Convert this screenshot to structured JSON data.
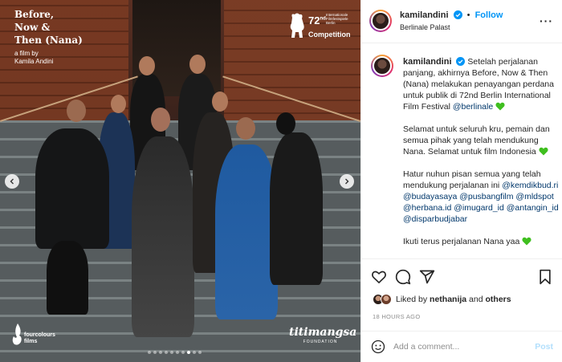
{
  "poster": {
    "title_lines": [
      "Before,",
      "Now &",
      "Then",
      "(Nana)"
    ],
    "subtitle_lines": [
      "a film by",
      "Kamila Andini"
    ],
    "festival_number": "72",
    "festival_superscript": "nd",
    "festival_name": "Internationale Filmfestspiele Berlin",
    "festival_section": "Competition",
    "logo_left_lines": [
      "fourcolours",
      "films"
    ],
    "logo_right_name": "titimangsa",
    "logo_right_sub": "FOUNDATION",
    "carousel": {
      "total": 10,
      "active_index": 7
    }
  },
  "header": {
    "username": "kamilandini",
    "separator": "•",
    "follow_label": "Follow",
    "location": "Berlinale Palast",
    "more_icon": "more-horizontal-icon"
  },
  "caption": {
    "username": "kamilandini",
    "p1_text": "Setelah perjalanan panjang, akhirnya Before, Now & Then (Nana) melakukan penayangan perdana untuk publik di 72nd Berlin International Film Festival",
    "p1_mention": "@berlinale",
    "p2_text": "Selamat untuk seluruh kru, pemain dan semua pihak yang telah mendukung Nana. Selamat untuk film Indonesia",
    "p3_text": "Hatur nuhun pisan semua yang telah mendukung perjalanan ini",
    "p3_mentions": [
      "@kemdikbud.ri",
      "@budayasaya",
      "@pusbangfilm",
      "@mldspot",
      "@herbana.id",
      "@imugard_id",
      "@antangin_id",
      "@disparbudjabar"
    ],
    "p4_text": "Ikuti terus perjalanan Nana yaa",
    "accent_heart_color": "#3fbf1f"
  },
  "likes": {
    "prefix": "Liked by",
    "user": "nethanija",
    "connector": "and",
    "others": "others"
  },
  "timestamp": "18 HOURS AGO",
  "comment": {
    "placeholder": "Add a comment...",
    "post_label": "Post"
  },
  "colors": {
    "link_blue": "#0095f6",
    "mention_blue": "#00376b",
    "muted": "#8e8e8e",
    "post_disabled": "#b2dffc"
  }
}
